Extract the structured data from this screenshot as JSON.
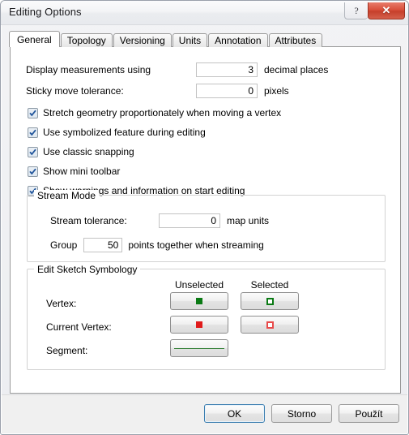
{
  "window": {
    "title": "Editing Options",
    "help_button": "?",
    "close_button": "✕"
  },
  "tabs": [
    {
      "label": "General",
      "active": true
    },
    {
      "label": "Topology",
      "active": false
    },
    {
      "label": "Versioning",
      "active": false
    },
    {
      "label": "Units",
      "active": false
    },
    {
      "label": "Annotation",
      "active": false
    },
    {
      "label": "Attributes",
      "active": false
    }
  ],
  "general": {
    "fields": [
      {
        "label": "Display measurements using",
        "value": "3",
        "suffix": "decimal places"
      },
      {
        "label": "Sticky move tolerance:",
        "value": "0",
        "suffix": "pixels"
      }
    ],
    "checkboxes": [
      {
        "label": "Stretch geometry proportionately when moving a vertex",
        "checked": true
      },
      {
        "label": "Use symbolized feature during editing",
        "checked": true
      },
      {
        "label": "Use classic snapping",
        "checked": true
      },
      {
        "label": "Show mini toolbar",
        "checked": true
      },
      {
        "label": "Show warnings and information on start editing",
        "checked": true
      }
    ],
    "stream_mode": {
      "title": "Stream Mode",
      "tolerance_label": "Stream tolerance:",
      "tolerance_value": "0",
      "tolerance_suffix": "map units",
      "group_prefix": "Group",
      "group_value": "50",
      "group_suffix": "points together when streaming"
    },
    "sketch_symbology": {
      "title": "Edit Sketch Symbology",
      "column_unselected": "Unselected",
      "column_selected": "Selected",
      "rows": [
        {
          "label": "Vertex:",
          "unselected_symbol": "filled-green-square",
          "selected_symbol": "hollow-green-square"
        },
        {
          "label": "Current Vertex:",
          "unselected_symbol": "filled-red-square",
          "selected_symbol": "hollow-red-square"
        },
        {
          "label": "Segment:",
          "unselected_symbol": "green-line",
          "selected_symbol": ""
        }
      ]
    }
  },
  "buttons": {
    "ok": "OK",
    "cancel": "Storno",
    "apply": "Použít"
  },
  "colors": {
    "vertex_green": "#0a7a14",
    "current_vertex_red": "#e01b1b",
    "segment_green": "#2f7d32",
    "close_button_red": "#d9503c",
    "default_button_border": "#3c7fb1"
  }
}
